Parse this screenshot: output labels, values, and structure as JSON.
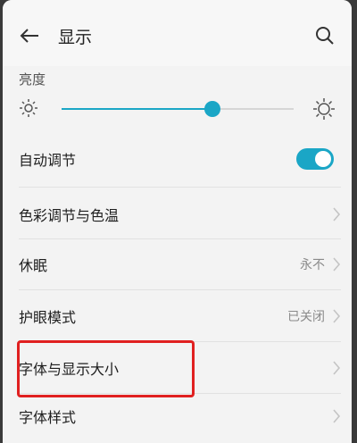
{
  "header": {
    "title": "显示"
  },
  "brightness": {
    "section_label": "亮度",
    "level_percent": 65
  },
  "settings": {
    "auto_adjust": {
      "label": "自动调节",
      "enabled": true
    },
    "color_temp": {
      "label": "色彩调节与色温"
    },
    "sleep": {
      "label": "休眠",
      "value": "永不"
    },
    "eye_comfort": {
      "label": "护眼模式",
      "value": "已关闭"
    },
    "font_display_size": {
      "label": "字体与显示大小"
    },
    "font_style": {
      "label": "字体样式"
    }
  },
  "colors": {
    "accent": "#1aa6c6",
    "highlight": "#e02020"
  }
}
